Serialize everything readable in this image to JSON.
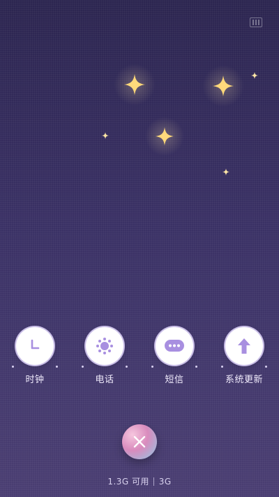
{
  "actions": [
    {
      "label": "时钟",
      "icon": "clock-icon"
    },
    {
      "label": "电话",
      "icon": "phone-icon"
    },
    {
      "label": "短信",
      "icon": "message-icon"
    },
    {
      "label": "系统更新",
      "icon": "update-arrow-icon"
    }
  ],
  "memory": {
    "available": "1.3G 可用",
    "total": "3G"
  },
  "colors": {
    "accent": "#9f7ee0",
    "star": "#ffd56e"
  }
}
